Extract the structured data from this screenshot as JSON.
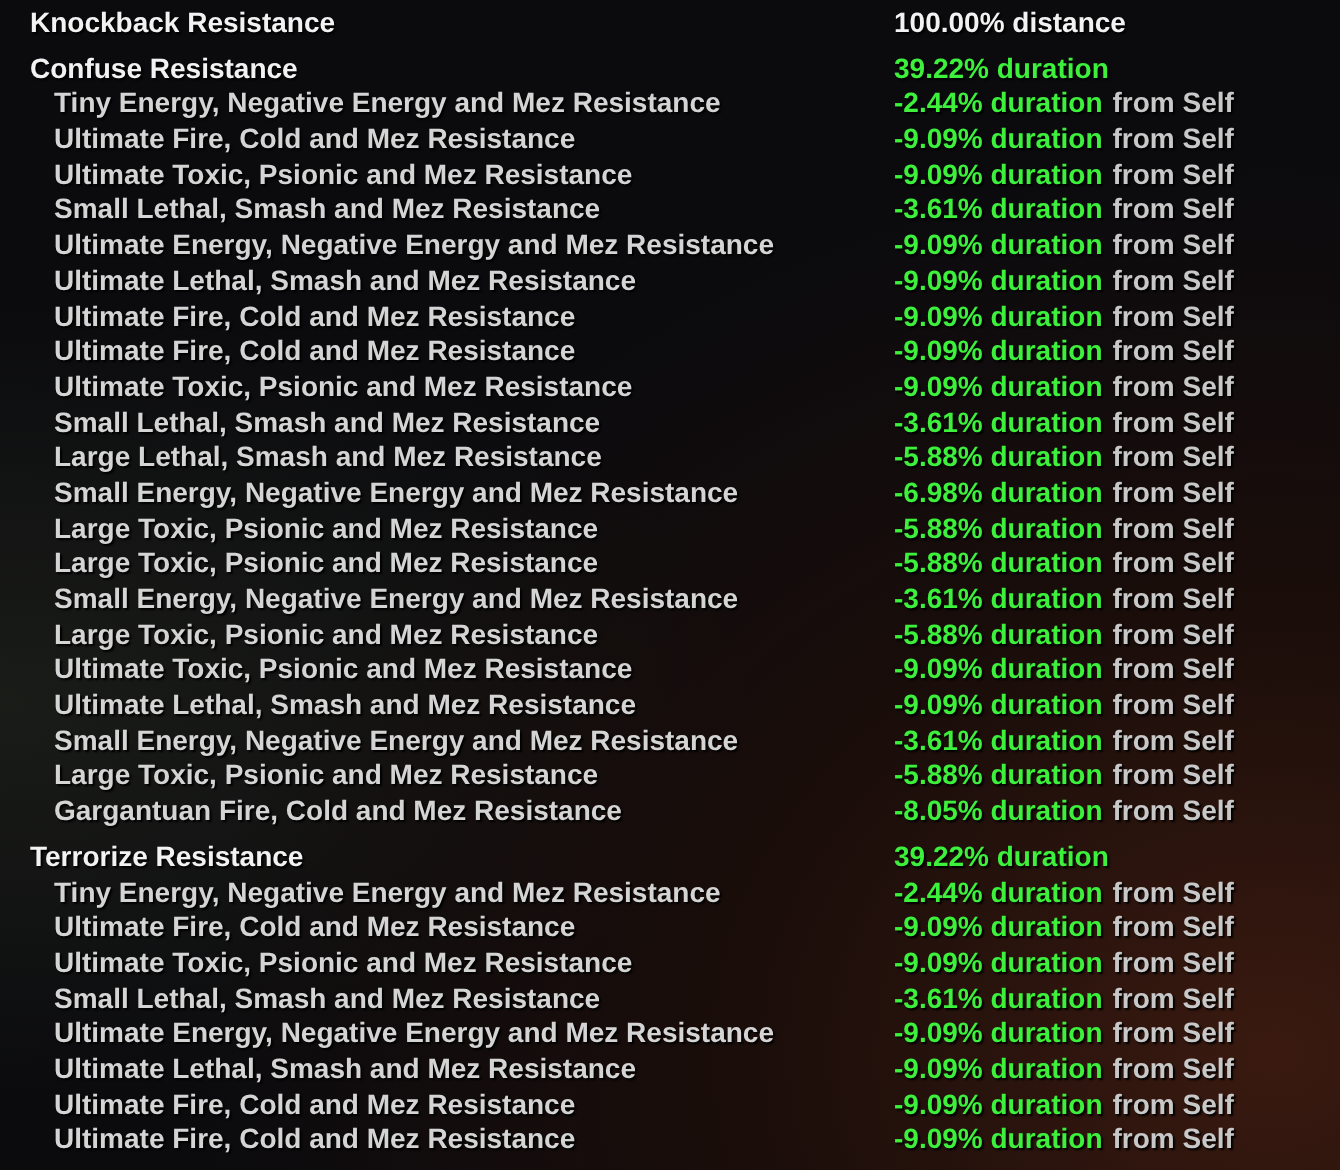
{
  "sections": [
    {
      "name": "Knockback Resistance",
      "value": "100.00% distance",
      "highlight": false
    },
    {
      "name": "Confuse Resistance",
      "value": "39.22% duration",
      "highlight": true,
      "rows": [
        {
          "label": "Tiny Energy, Negative Energy and Mez Resistance",
          "value": "-2.44% duration",
          "source": "from Self"
        },
        {
          "label": "Ultimate Fire, Cold and Mez Resistance",
          "value": "-9.09% duration",
          "source": "from Self"
        },
        {
          "label": "Ultimate Toxic, Psionic and Mez Resistance",
          "value": "-9.09% duration",
          "source": "from Self"
        },
        {
          "label": "Small Lethal, Smash and Mez Resistance",
          "value": "-3.61% duration",
          "source": "from Self"
        },
        {
          "label": "Ultimate Energy, Negative Energy and Mez Resistance",
          "value": "-9.09% duration",
          "source": "from Self"
        },
        {
          "label": "Ultimate Lethal, Smash and Mez Resistance",
          "value": "-9.09% duration",
          "source": "from Self"
        },
        {
          "label": "Ultimate Fire, Cold and Mez Resistance",
          "value": "-9.09% duration",
          "source": "from Self"
        },
        {
          "label": "Ultimate Fire, Cold and Mez Resistance",
          "value": "-9.09% duration",
          "source": "from Self"
        },
        {
          "label": "Ultimate Toxic, Psionic and Mez Resistance",
          "value": "-9.09% duration",
          "source": "from Self"
        },
        {
          "label": "Small Lethal, Smash and Mez Resistance",
          "value": "-3.61% duration",
          "source": "from Self"
        },
        {
          "label": "Large Lethal, Smash and Mez Resistance",
          "value": "-5.88% duration",
          "source": "from Self"
        },
        {
          "label": "Small Energy, Negative Energy and Mez Resistance",
          "value": "-6.98% duration",
          "source": "from Self"
        },
        {
          "label": "Large Toxic, Psionic and Mez Resistance",
          "value": "-5.88% duration",
          "source": "from Self"
        },
        {
          "label": "Large Toxic, Psionic and Mez Resistance",
          "value": "-5.88% duration",
          "source": "from Self"
        },
        {
          "label": "Small Energy, Negative Energy and Mez Resistance",
          "value": "-3.61% duration",
          "source": "from Self"
        },
        {
          "label": "Large Toxic, Psionic and Mez Resistance",
          "value": "-5.88% duration",
          "source": "from Self"
        },
        {
          "label": "Ultimate Toxic, Psionic and Mez Resistance",
          "value": "-9.09% duration",
          "source": "from Self"
        },
        {
          "label": "Ultimate Lethal, Smash and Mez Resistance",
          "value": "-9.09% duration",
          "source": "from Self"
        },
        {
          "label": "Small Energy, Negative Energy and Mez Resistance",
          "value": "-3.61% duration",
          "source": "from Self"
        },
        {
          "label": "Large Toxic, Psionic and Mez Resistance",
          "value": "-5.88% duration",
          "source": "from Self"
        },
        {
          "label": "Gargantuan Fire, Cold and Mez Resistance",
          "value": "-8.05% duration",
          "source": "from Self"
        }
      ]
    },
    {
      "name": "Terrorize Resistance",
      "value": "39.22% duration",
      "highlight": true,
      "rows": [
        {
          "label": "Tiny Energy, Negative Energy and Mez Resistance",
          "value": "-2.44% duration",
          "source": "from Self"
        },
        {
          "label": "Ultimate Fire, Cold and Mez Resistance",
          "value": "-9.09% duration",
          "source": "from Self"
        },
        {
          "label": "Ultimate Toxic, Psionic and Mez Resistance",
          "value": "-9.09% duration",
          "source": "from Self"
        },
        {
          "label": "Small Lethal, Smash and Mez Resistance",
          "value": "-3.61% duration",
          "source": "from Self"
        },
        {
          "label": "Ultimate Energy, Negative Energy and Mez Resistance",
          "value": "-9.09% duration",
          "source": "from Self"
        },
        {
          "label": "Ultimate Lethal, Smash and Mez Resistance",
          "value": "-9.09% duration",
          "source": "from Self"
        },
        {
          "label": "Ultimate Fire, Cold and Mez Resistance",
          "value": "-9.09% duration",
          "source": "from Self"
        },
        {
          "label": "Ultimate Fire, Cold and Mez Resistance",
          "value": "-9.09% duration",
          "source": "from Self"
        }
      ]
    }
  ]
}
